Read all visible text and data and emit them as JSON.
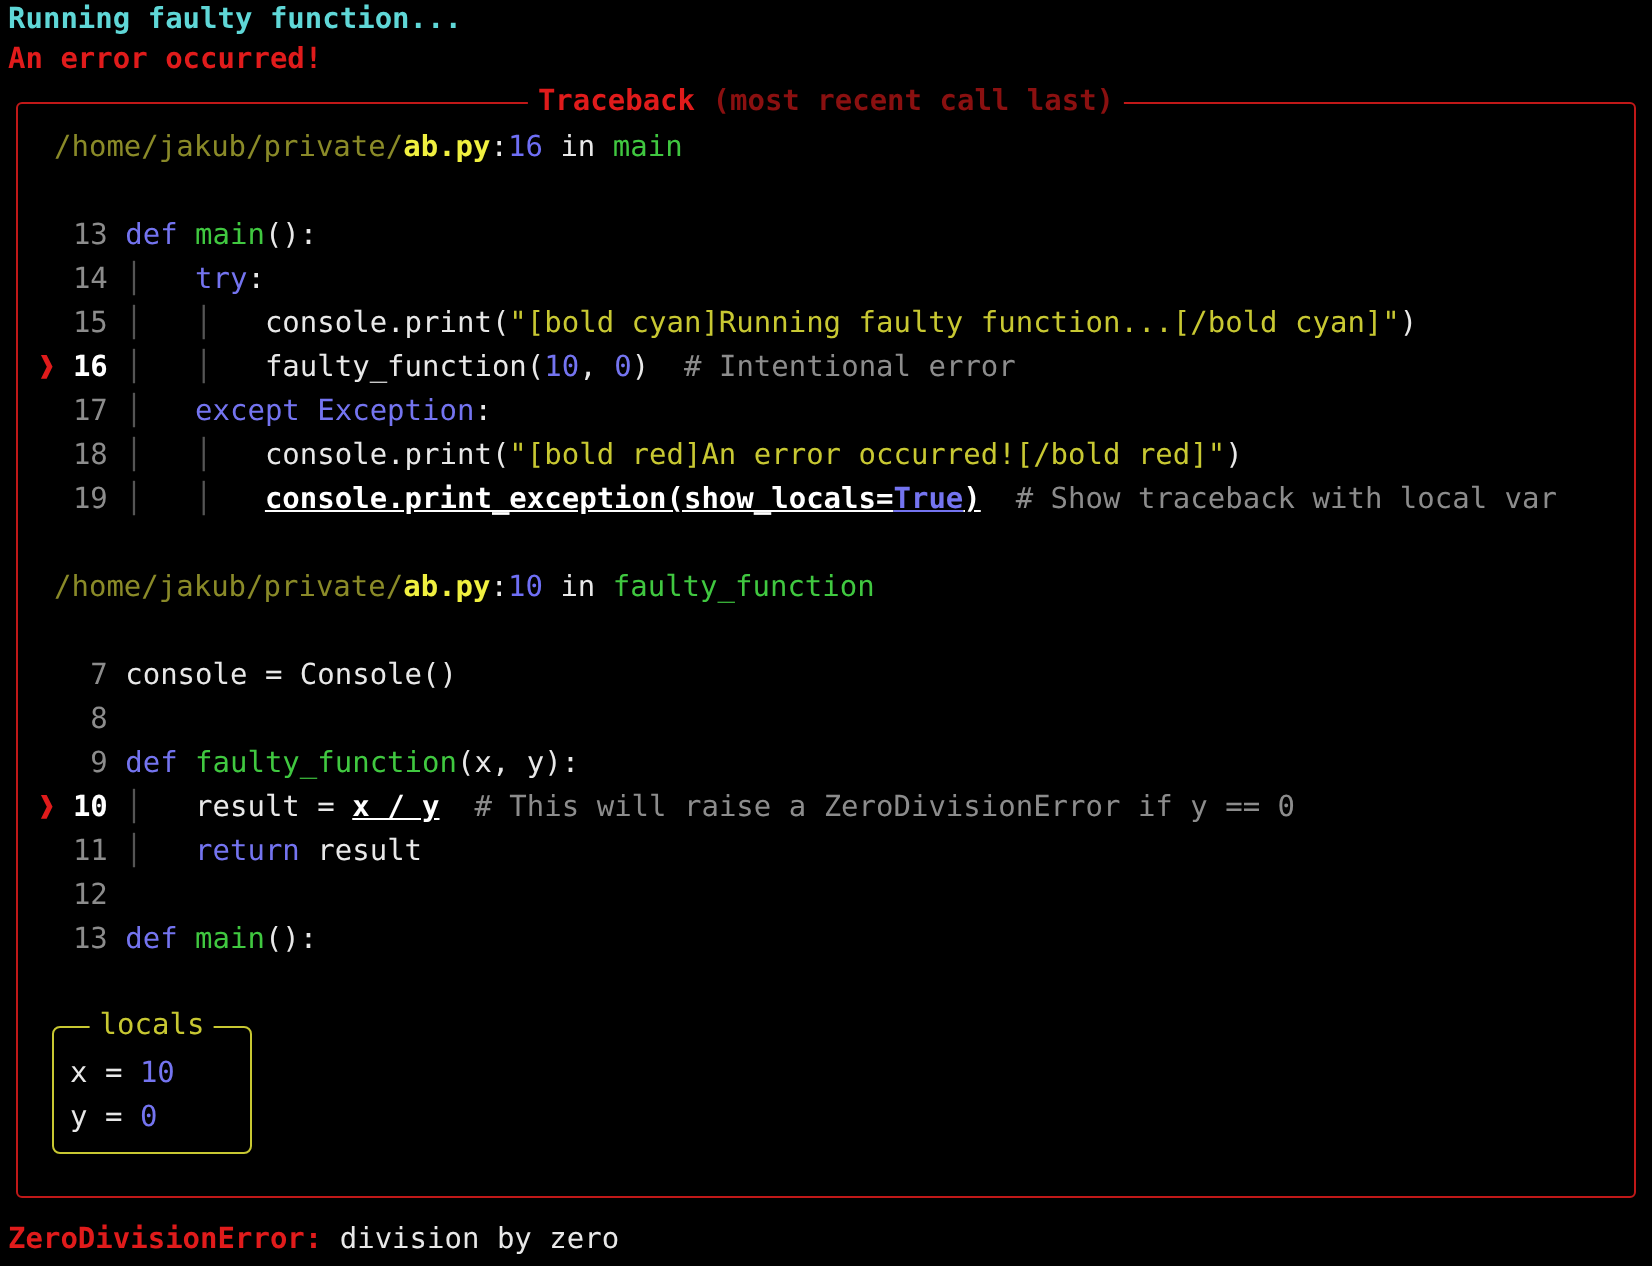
{
  "output": [
    {
      "kind": "info",
      "text": "Running faulty function..."
    },
    {
      "kind": "error",
      "text": "An error occurred!"
    }
  ],
  "traceback": {
    "title": "Traceback",
    "subtitle": "(most recent call last)",
    "marker": "❱",
    "frames": [
      {
        "location": {
          "dir": "/home/jakub/private/",
          "file": "ab.py",
          "sep": ":",
          "line": "16",
          "in": " in ",
          "function": "main"
        },
        "lines": [
          {
            "number": "13",
            "current": false,
            "tokens": [
              {
                "kind": "kw",
                "text": "def "
              },
              {
                "kind": "func",
                "text": "main"
              },
              {
                "kind": "text",
                "text": "():"
              }
            ]
          },
          {
            "number": "14",
            "current": false,
            "tokens": [
              {
                "kind": "guide",
                "text": "│   "
              },
              {
                "kind": "kw",
                "text": "try"
              },
              {
                "kind": "text",
                "text": ":"
              }
            ]
          },
          {
            "number": "15",
            "current": false,
            "tokens": [
              {
                "kind": "guide",
                "text": "│   │   "
              },
              {
                "kind": "text",
                "text": "console.print("
              },
              {
                "kind": "str",
                "text": "\"[bold cyan]Running faulty function...[/bold cyan]\""
              },
              {
                "kind": "text",
                "text": ")"
              }
            ]
          },
          {
            "number": "16",
            "current": true,
            "tokens": [
              {
                "kind": "guide",
                "text": "│   │   "
              },
              {
                "kind": "text",
                "text": "faulty_function("
              },
              {
                "kind": "num",
                "text": "10"
              },
              {
                "kind": "text",
                "text": ", "
              },
              {
                "kind": "num",
                "text": "0"
              },
              {
                "kind": "text",
                "text": ")  "
              },
              {
                "kind": "comment",
                "text": "# Intentional error"
              }
            ]
          },
          {
            "number": "17",
            "current": false,
            "tokens": [
              {
                "kind": "guide",
                "text": "│   "
              },
              {
                "kind": "kw",
                "text": "except Exception"
              },
              {
                "kind": "text",
                "text": ":"
              }
            ]
          },
          {
            "number": "18",
            "current": false,
            "tokens": [
              {
                "kind": "guide",
                "text": "│   │   "
              },
              {
                "kind": "text",
                "text": "console.print("
              },
              {
                "kind": "str",
                "text": "\"[bold red]An error occurred![/bold red]\""
              },
              {
                "kind": "text",
                "text": ")"
              }
            ]
          },
          {
            "number": "19",
            "current": false,
            "tokens": [
              {
                "kind": "guide",
                "text": "│   │   "
              },
              {
                "kind": "hl",
                "text": "console.print_exception(show_locals="
              },
              {
                "kind": "hl-const",
                "text": "True"
              },
              {
                "kind": "hl",
                "text": ")"
              },
              {
                "kind": "comment",
                "text": "  # Show traceback with local var"
              }
            ]
          }
        ]
      },
      {
        "location": {
          "dir": "/home/jakub/private/",
          "file": "ab.py",
          "sep": ":",
          "line": "10",
          "in": " in ",
          "function": "faulty_function"
        },
        "lines": [
          {
            "number": "7",
            "current": false,
            "tokens": [
              {
                "kind": "text",
                "text": "console = Console()"
              }
            ]
          },
          {
            "number": "8",
            "current": false
          },
          {
            "number": "9",
            "current": false,
            "tokens": [
              {
                "kind": "kw",
                "text": "def "
              },
              {
                "kind": "func",
                "text": "faulty_function"
              },
              {
                "kind": "text",
                "text": "(x, y):"
              }
            ]
          },
          {
            "number": "10",
            "current": true,
            "tokens": [
              {
                "kind": "guide",
                "text": "│   "
              },
              {
                "kind": "text",
                "text": "result = "
              },
              {
                "kind": "hl",
                "text": "x / y"
              },
              {
                "kind": "comment",
                "text": "  # This will raise a ZeroDivisionError if y == 0"
              }
            ]
          },
          {
            "number": "11",
            "current": false,
            "tokens": [
              {
                "kind": "guide",
                "text": "│   "
              },
              {
                "kind": "kw",
                "text": "return"
              },
              {
                "kind": "text",
                "text": " result"
              }
            ]
          },
          {
            "number": "12",
            "current": false
          },
          {
            "number": "13",
            "current": false,
            "tokens": [
              {
                "kind": "kw",
                "text": "def "
              },
              {
                "kind": "func",
                "text": "main"
              },
              {
                "kind": "text",
                "text": "():"
              }
            ]
          }
        ]
      }
    ],
    "locals": {
      "title": "locals",
      "entries": [
        {
          "name": "x",
          "op": " = ",
          "value": "10"
        },
        {
          "name": "y",
          "op": " = ",
          "value": "0"
        }
      ]
    }
  },
  "exception": {
    "type": "ZeroDivisionError:",
    "message": " division by zero"
  }
}
